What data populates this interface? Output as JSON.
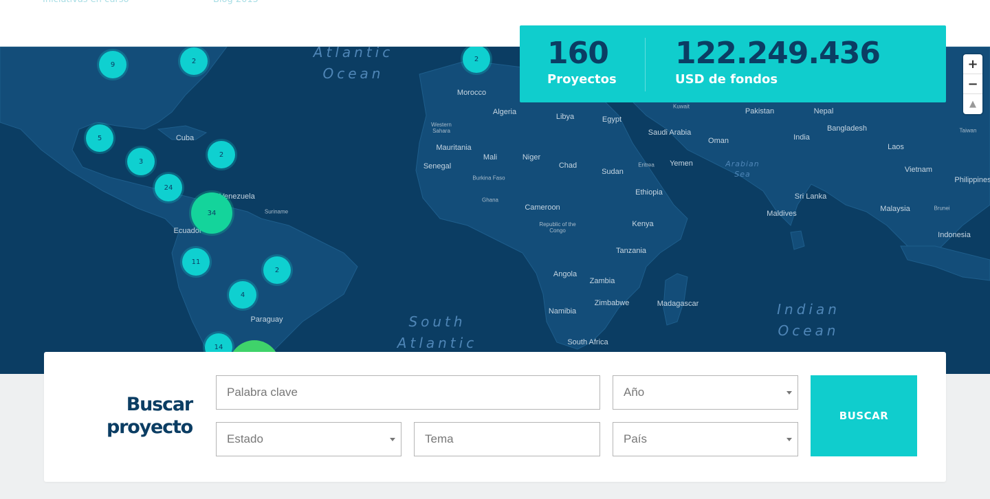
{
  "header": {
    "crumb_1": "Iniciativas en curso",
    "crumb_2": "Blog 2015"
  },
  "stats": {
    "projects_value": "160",
    "projects_label": "Proyectos",
    "funds_value": "122.249.436",
    "funds_label": "USD de fondos"
  },
  "map": {
    "zoom_in": "+",
    "zoom_out": "−",
    "reset": "▲",
    "oceans": [
      {
        "line1": "Atlantic",
        "line2": "Ocean"
      },
      {
        "line1": "South",
        "line2": "Atlantic"
      },
      {
        "line1": "Indian",
        "line2": "Ocean"
      },
      {
        "line1": "Arabian",
        "line2": "Sea"
      }
    ],
    "labels": [
      "Morocco",
      "Algeria",
      "Libya",
      "Egypt",
      "Western Sahara",
      "Mauritania",
      "Mali",
      "Niger",
      "Chad",
      "Sudan",
      "Senegal",
      "Burkina Faso",
      "Ghana",
      "Eritrea",
      "Yemen",
      "Oman",
      "Saudi Arabia",
      "Kuwait",
      "Pakistan",
      "Nepal",
      "India",
      "Bangladesh",
      "Laos",
      "Vietnam",
      "Taiwan",
      "Philippines",
      "Ethiopia",
      "Cameroon",
      "Republic of the Congo",
      "Kenya",
      "Tanzania",
      "Angola",
      "Zambia",
      "Zimbabwe",
      "Namibia",
      "South Africa",
      "Madagascar",
      "Sri Lanka",
      "Maldives",
      "Malaysia",
      "Brunei",
      "Indonesia",
      "Cuba",
      "Venezuela",
      "Suriname",
      "Ecuador",
      "Paraguay"
    ],
    "clusters": [
      "9",
      "2",
      "2",
      "5",
      "3",
      "2",
      "24",
      "34",
      "11",
      "2",
      "4",
      "14",
      ""
    ]
  },
  "search": {
    "title_line1": "Buscar",
    "title_line2": "proyecto",
    "keyword_placeholder": "Palabra clave",
    "year_placeholder": "Año",
    "state_placeholder": "Estado",
    "topic_placeholder": "Tema",
    "country_placeholder": "País",
    "button": "BUSCAR"
  },
  "colors": {
    "navy": "#0b3d63",
    "teal": "#10cdcd",
    "cluster_mid": "#14d49b",
    "cluster_big": "#3fd36a"
  }
}
